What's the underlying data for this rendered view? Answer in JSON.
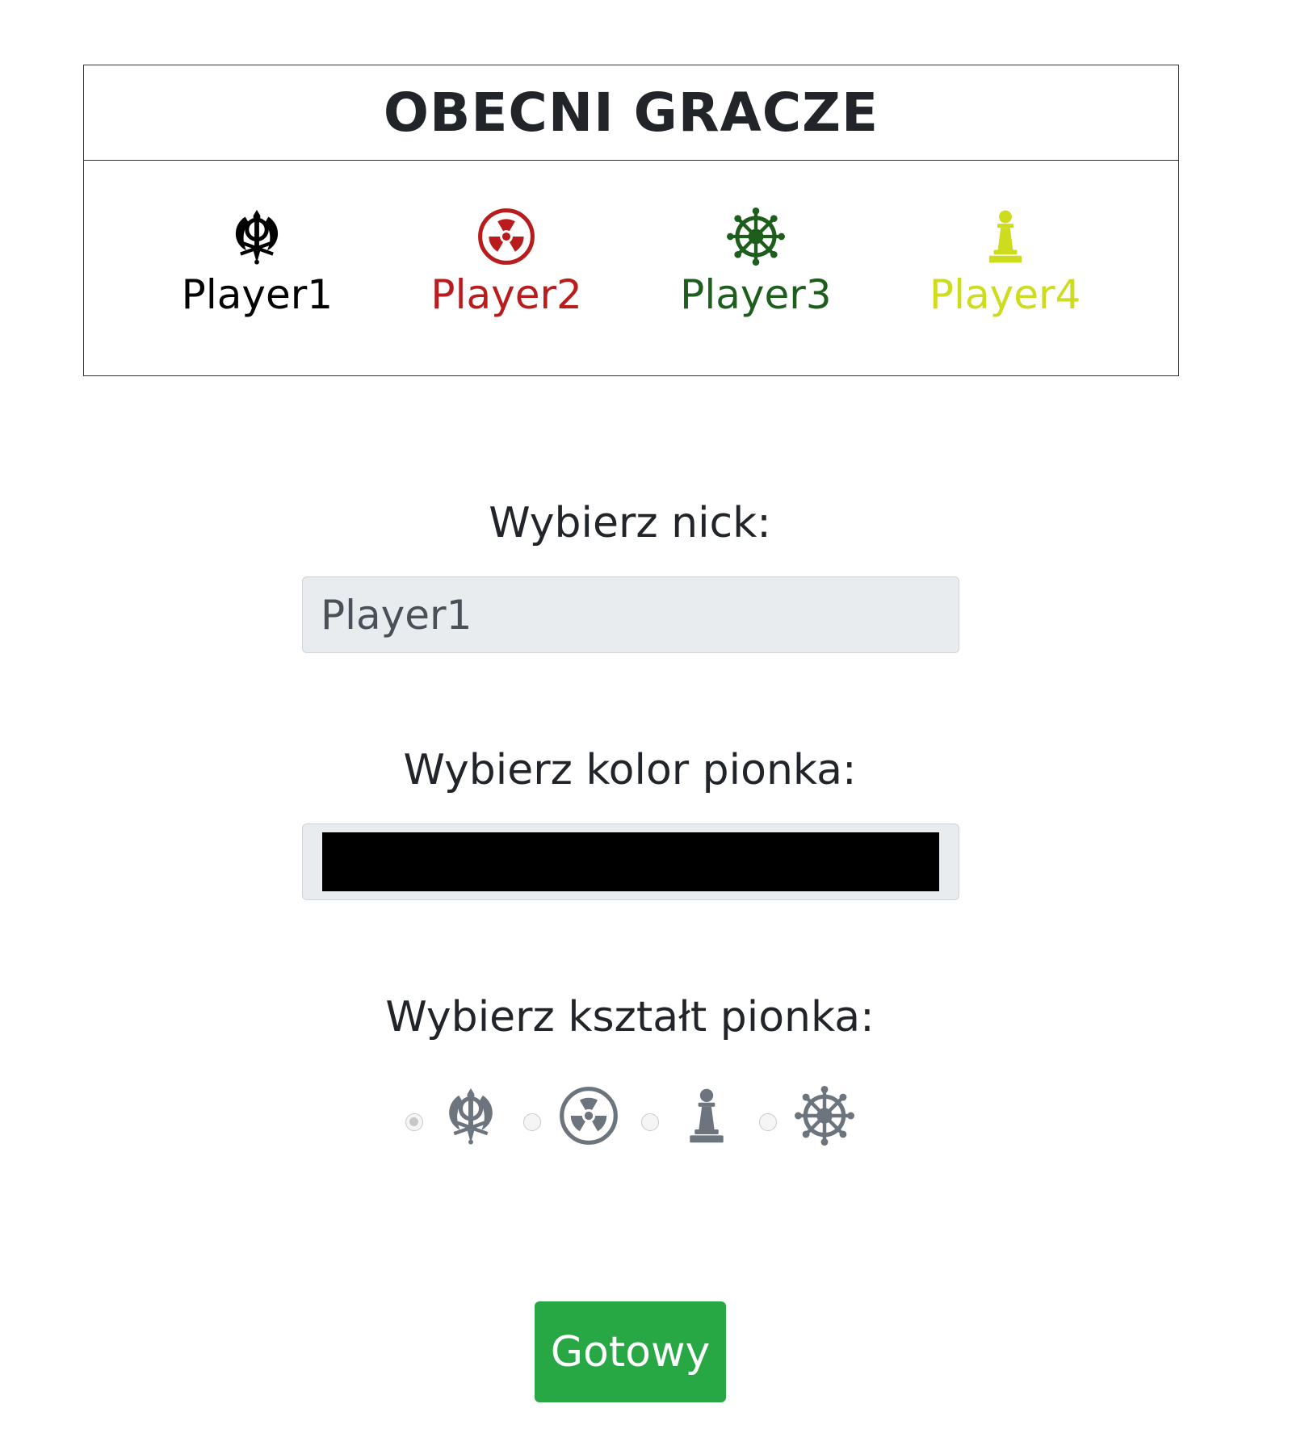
{
  "players_panel": {
    "title": "OBECNI GRACZE",
    "players": [
      {
        "name": "Player1",
        "icon": "khanda-icon",
        "color": "#000000"
      },
      {
        "name": "Player2",
        "icon": "radiation-icon",
        "color": "#b91c1c"
      },
      {
        "name": "Player3",
        "icon": "dharmachakra-icon",
        "color": "#1d5e1d"
      },
      {
        "name": "Player4",
        "icon": "chess-pawn-icon",
        "color": "#cddc1c"
      }
    ]
  },
  "form": {
    "nick_label": "Wybierz nick:",
    "nick_value": "Player1",
    "color_label": "Wybierz kolor pionka:",
    "color_value": "#000000",
    "shape_label": "Wybierz kształt pionka:",
    "shapes": [
      {
        "icon": "khanda-icon",
        "selected": true
      },
      {
        "icon": "radiation-icon",
        "selected": false
      },
      {
        "icon": "chess-pawn-icon",
        "selected": false
      },
      {
        "icon": "dharmachakra-icon",
        "selected": false
      }
    ],
    "shape_icon_color": "#6c757d",
    "submit_label": "Gotowy",
    "submit_color": "#28a745"
  }
}
